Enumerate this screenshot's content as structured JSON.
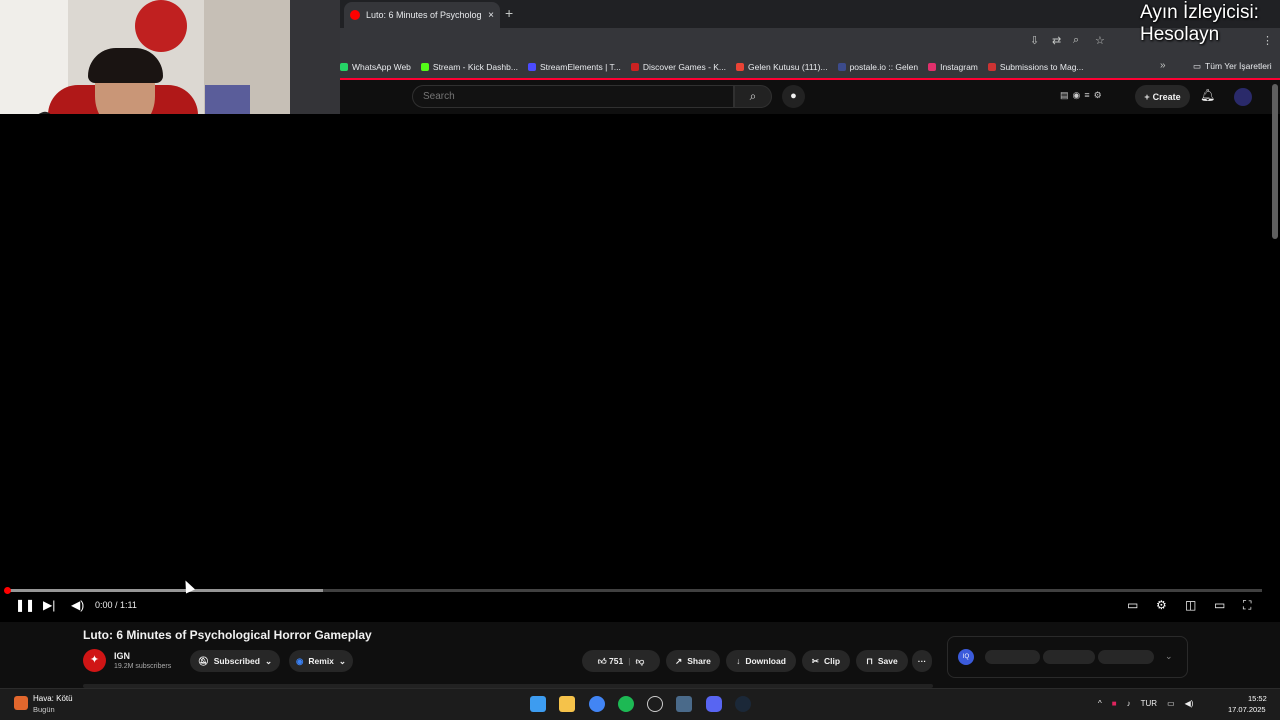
{
  "overlay": {
    "line1": "Ayın İzleyicisi:",
    "line2": "Hesolayn"
  },
  "browser": {
    "tab_title": "Luto: 6 Minutes of Psychologic...",
    "tab_close": "×",
    "new_tab": "+",
    "bookmarks": [
      {
        "label": "WhatsApp Web",
        "color": "#25d366"
      },
      {
        "label": "Stream - Kick Dashb...",
        "color": "#53fc18"
      },
      {
        "label": "StreamElements | T...",
        "color": "#4b4bff"
      },
      {
        "label": "Discover Games - K...",
        "color": "#111111"
      },
      {
        "label": "Gelen Kutusu (111)...",
        "color": "#ea4335"
      },
      {
        "label": "postale.io :: Gelen",
        "color": "#3c4b8c"
      },
      {
        "label": "Instagram",
        "color": "#e1306c"
      },
      {
        "label": "Submissions to Mag...",
        "color": "#cc3333"
      }
    ],
    "bookmarks_more": "»",
    "all_bookmarks": "Tüm Yer İşaretleri"
  },
  "youtube": {
    "search_placeholder": "Search",
    "create_label": "Create",
    "player": {
      "time": "0:00 / 1:11",
      "played_fraction": 0.0,
      "buffered_fraction": 0.253
    },
    "video_title": "Luto: 6 Minutes of Psychological Horror Gameplay",
    "channel": {
      "name": "IGN",
      "subscribers": "19.2M subscribers"
    },
    "buttons": {
      "subscribed": "Subscribed",
      "remix": "Remix",
      "likes": "751",
      "share": "Share",
      "download": "Download",
      "clip": "Clip",
      "save": "Save",
      "more": "···"
    },
    "iq_logo": "IQ"
  },
  "taskbar": {
    "weather_title": "Hava: Kötü",
    "weather_sub": "Bugün",
    "language": "TUR",
    "time": "15:52",
    "date": "17.07.2025"
  }
}
